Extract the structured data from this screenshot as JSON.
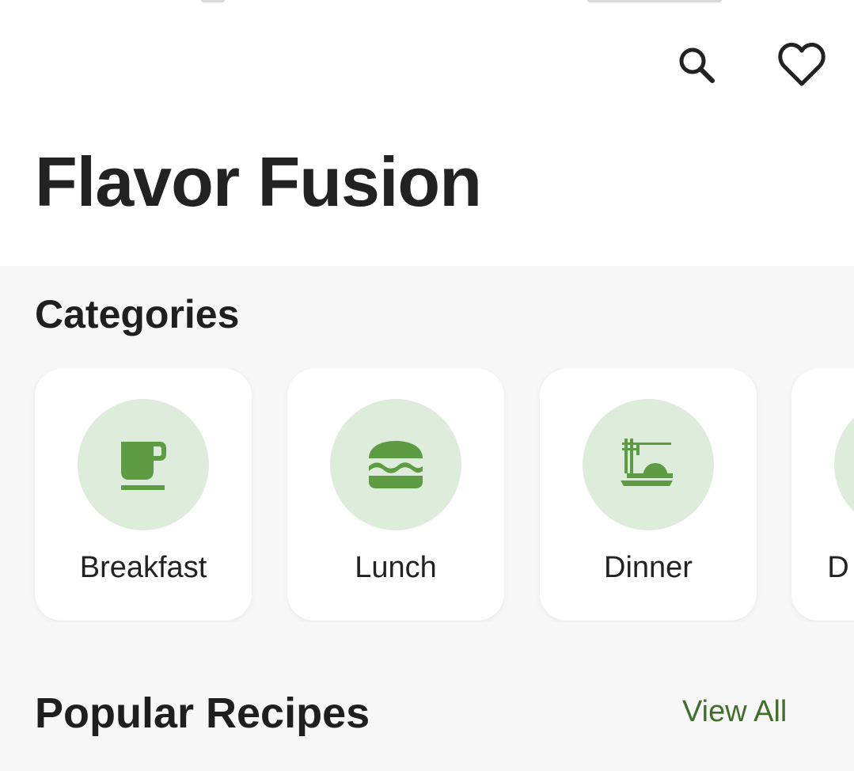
{
  "app": {
    "title": "Flavor Fusion"
  },
  "header": {
    "search_icon": "search-icon",
    "favorites_icon": "heart-outline-icon"
  },
  "categories": {
    "title": "Categories",
    "items": [
      {
        "label": "Breakfast",
        "icon": "coffee-cup-icon"
      },
      {
        "label": "Lunch",
        "icon": "burger-icon"
      },
      {
        "label": "Dinner",
        "icon": "dinner-plate-icon"
      },
      {
        "label": "D",
        "icon": "partial-category-icon"
      }
    ]
  },
  "popular": {
    "title": "Popular Recipes",
    "view_all_label": "View All"
  },
  "colors": {
    "accent_green": "#5d9c43",
    "accent_green_light": "#deecdb",
    "link_green": "#3f6f2a",
    "text_dark": "#222222",
    "background": "#f7f7f7"
  }
}
